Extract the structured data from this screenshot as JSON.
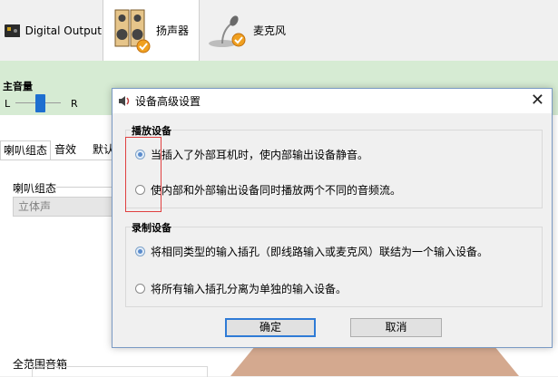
{
  "device_tabs": [
    {
      "label": "Digital Output",
      "icon": "digital-output-device-icon"
    },
    {
      "label": "扬声器",
      "icon": "speaker-device-icon"
    },
    {
      "label": "麦克风",
      "icon": "microphone-device-icon"
    }
  ],
  "main_volume": {
    "label": "主音量",
    "left": "L",
    "right": "R",
    "balance_level": 0.5
  },
  "sub_tabs": [
    "喇叭组态",
    "音效",
    "默认"
  ],
  "speaker_config": {
    "group_label": "喇叭组态",
    "selected": "立体声"
  },
  "full_range": {
    "label": "全范围音箱"
  },
  "dialog": {
    "title": "设备高级设置",
    "close_label": "✕",
    "playback": {
      "title": "播放设备",
      "options": [
        {
          "label": "当插入了外部耳机时，使内部输出设备静音。",
          "checked": true
        },
        {
          "label": "使内部和外部输出设备同时播放两个不同的音频流。",
          "checked": false
        }
      ]
    },
    "record": {
      "title": "录制设备",
      "options": [
        {
          "label": "将相同类型的输入插孔（即线路输入或麦克风）联结为一个输入设备。",
          "checked": true
        },
        {
          "label": "将所有输入插孔分离为单独的输入设备。",
          "checked": false
        }
      ]
    },
    "ok_label": "确定",
    "cancel_label": "取消"
  },
  "colors": {
    "accent": "#1e6fd0",
    "green_panel": "#d6ebd3",
    "highlight_box": "#e04040"
  }
}
